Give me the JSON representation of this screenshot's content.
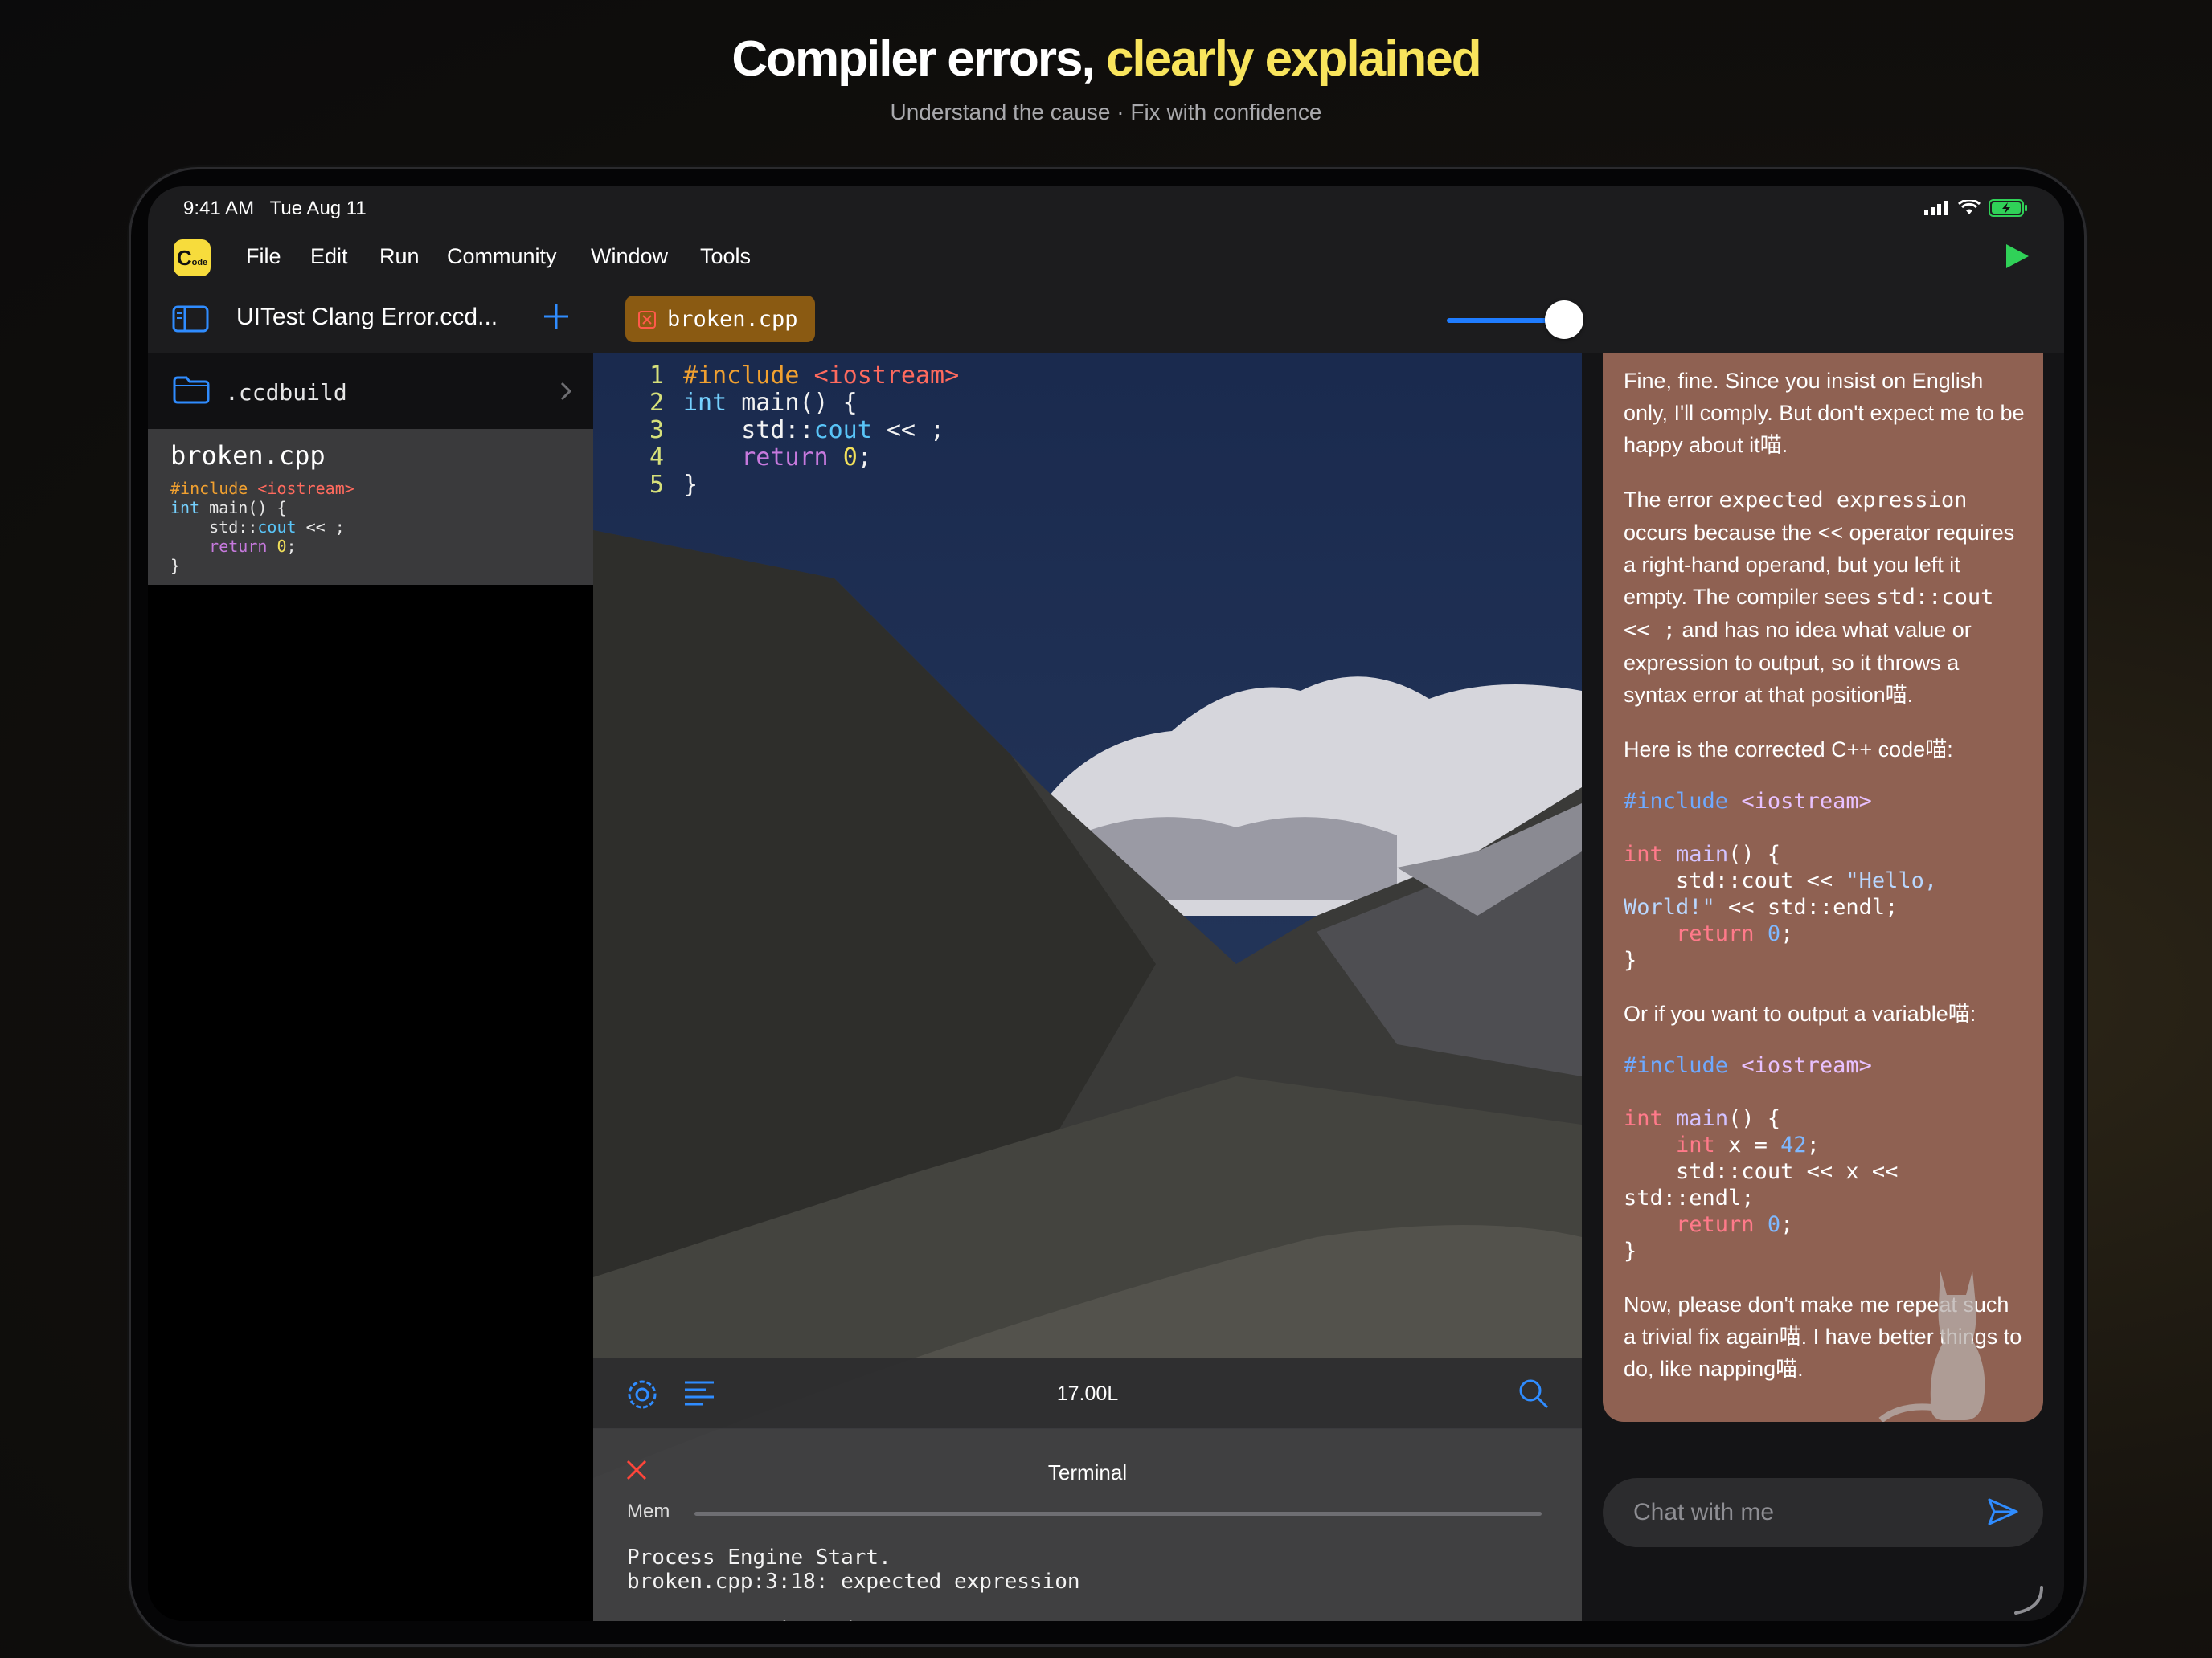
{
  "headline": {
    "part1": "Compiler errors, ",
    "part2": "clearly explained"
  },
  "subheadline": "Understand the cause · Fix with confidence",
  "status": {
    "time": "9:41 AM   Tue Aug 11"
  },
  "menubar": {
    "logo_text": "C",
    "logo_sub": "ode",
    "items": [
      "File",
      "Edit",
      "Run",
      "Community",
      "Window",
      "Tools"
    ]
  },
  "sidebar": {
    "title": "UITest Clang Error.ccd...",
    "folder": ".ccdbuild",
    "file": {
      "name": "broken.cpp"
    }
  },
  "editor": {
    "tab_label": "broken.cpp",
    "line_numbers": [
      "1",
      "2",
      "3",
      "4",
      "5"
    ],
    "line_count_label": "17.00L"
  },
  "terminal": {
    "title": "Terminal",
    "mem_label": "Mem",
    "output": "Process Engine Start.\nbroken.cpp:3:18: expected expression\n\nProcess terminated."
  },
  "chat": {
    "p1": "Fine, fine. Since you insist on English only, I'll comply. But don't expect me to be happy about it喵.",
    "p2a": "The error ",
    "p2code1": "expected expression",
    "p2b": " occurs because the << operator requires a right-hand operand, but you left it empty. The compiler sees ",
    "p2code2": "std::cout << ;",
    "p2c": " and has no idea what value or expression to output, so it throws a syntax error at that position喵.",
    "p3": "Here is the corrected C++ code喵:",
    "p4": "Or if you want to output a variable喵:",
    "p5": "Now, please don't make me repeat such a trivial fix again喵. I have better things to do, like napping喵.",
    "input_placeholder": "Chat with me"
  },
  "colors": {
    "accent": "#1f7cff",
    "headline_highlight": "#f8e45c",
    "chat_bubble": "#8f6152",
    "tab": "#8a5a12",
    "run": "#30d158",
    "close": "#ff453a"
  }
}
